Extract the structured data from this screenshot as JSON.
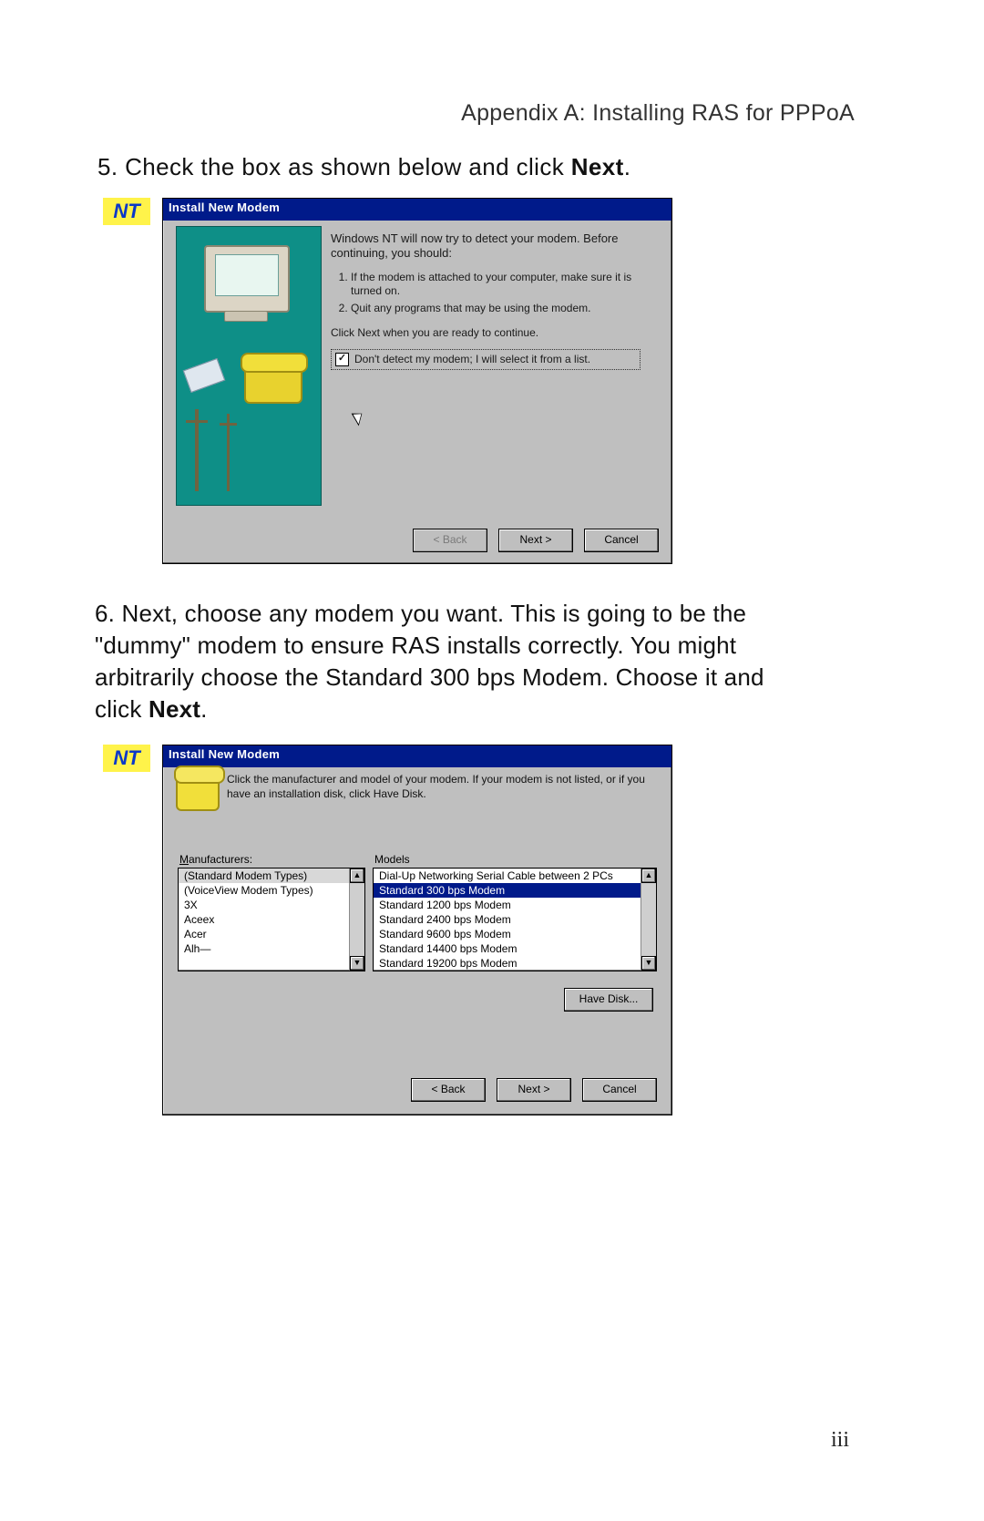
{
  "header": "Appendix A: Installing RAS for PPPoA",
  "step5": {
    "num": "5.",
    "text": "Check the box as shown below and click ",
    "bold": "Next",
    "end": "."
  },
  "nt_label": "NT",
  "dialog1": {
    "title": "Install New Modem",
    "intro": "Windows NT will now try to detect your modem. Before continuing, you should:",
    "li1": "If the modem is attached to your computer, make sure it is turned on.",
    "li2": "Quit any programs that may be using the modem.",
    "ready": "Click Next when you are ready to continue.",
    "checkbox_label": "Don't detect my modem; I will select it from a list.",
    "btn_back": "< Back",
    "btn_next": "Next >",
    "btn_cancel": "Cancel"
  },
  "step6": {
    "num": "6.",
    "line1": "Next, choose any modem you want. This is going to be the",
    "line2": "\"dummy\" modem to ensure RAS installs correctly. You might",
    "line3": "arbitrarily choose the Standard 300 bps Modem. Choose it and",
    "line4_a": "click ",
    "line4_b": "Next",
    "line4_c": "."
  },
  "dialog2": {
    "title": "Install New Modem",
    "intro": "Click the manufacturer and model of your modem. If your modem is not listed, or if you have an installation disk, click Have Disk.",
    "manufacturers_label": "Manufacturers:",
    "models_label": "Models",
    "manufacturers": [
      "(Standard Modem Types)",
      "(VoiceView Modem Types)",
      "3X",
      "Aceex",
      "Acer",
      "Alh—"
    ],
    "models": [
      "Dial-Up Networking Serial Cable between 2 PCs",
      "Standard   300 bps Modem",
      "Standard 1200 bps Modem",
      "Standard 2400 bps Modem",
      "Standard 9600 bps Modem",
      "Standard 14400 bps Modem",
      "Standard 19200 bps Modem"
    ],
    "btn_have_disk": "Have Disk...",
    "btn_back": "< Back",
    "btn_next": "Next >",
    "btn_cancel": "Cancel"
  },
  "page_number": "iii"
}
